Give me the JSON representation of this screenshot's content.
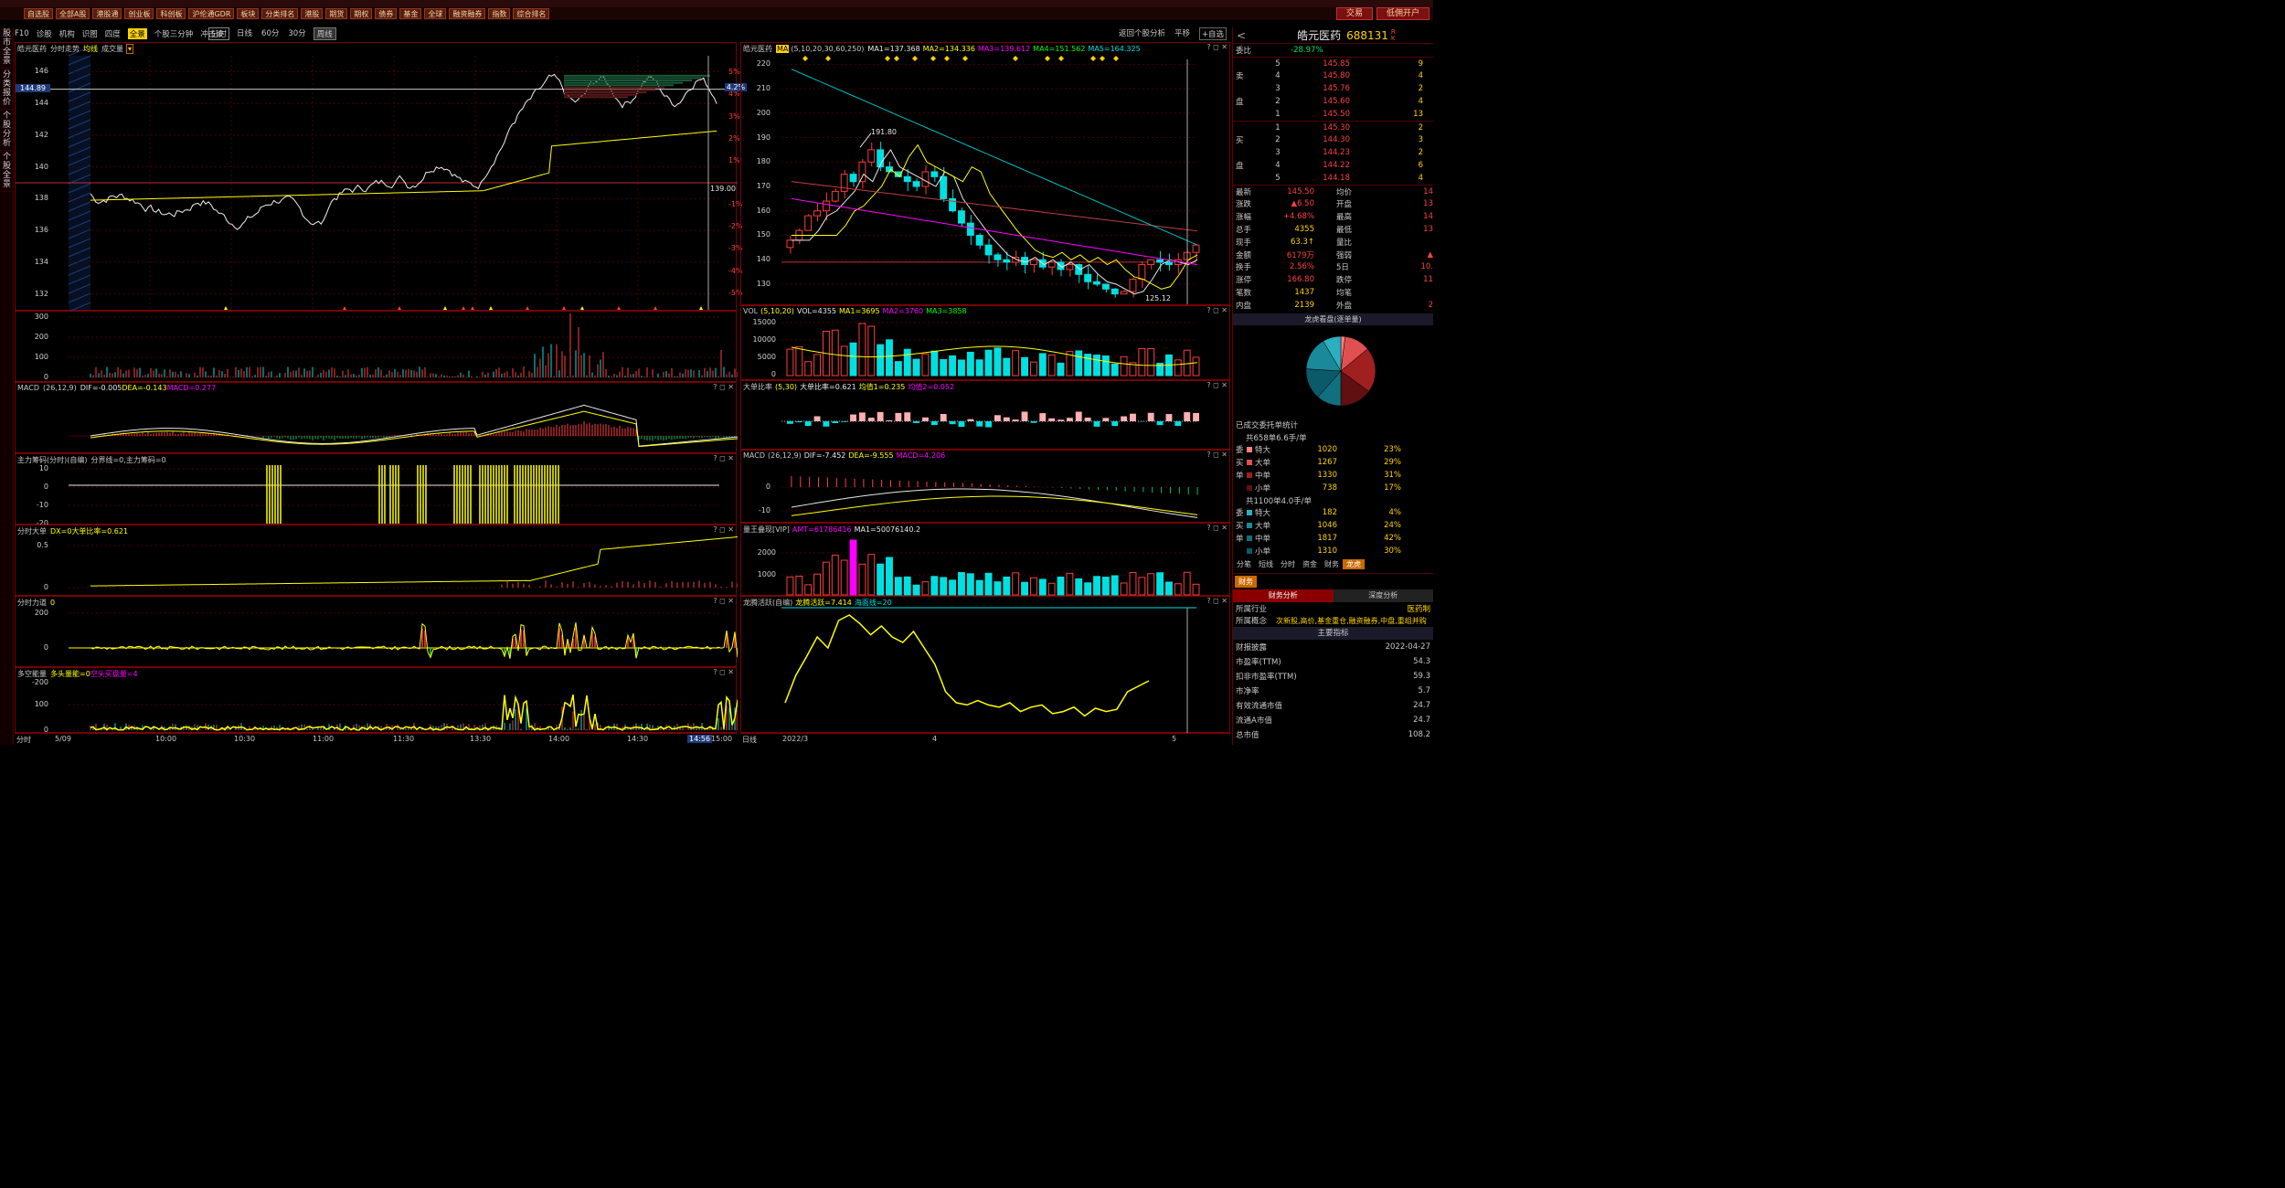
{
  "menu": [
    "自选股",
    "全部A股",
    "港股通",
    "创业板",
    "科创板",
    "沪伦通GDR",
    "板块",
    "分类排名",
    "港股",
    "期货",
    "期权",
    "债券",
    "基金",
    "全球",
    "融资融券",
    "指数",
    "综合排名"
  ],
  "trade": {
    "buy": "交易",
    "open_account": "低佣开户"
  },
  "left_tabs": [
    "股市全景",
    "分类报价",
    "个股分析",
    "个股全景"
  ],
  "toolbar": [
    "F10",
    "诊股",
    "机构",
    "识图",
    "四度",
    "全景",
    "个股三分钟",
    "冲击波"
  ],
  "periods": {
    "items": [
      "分时",
      "日线",
      "60分",
      "30分"
    ],
    "week": "周线"
  },
  "right_toolbar": {
    "back": "返回个股分析",
    "flat": "平移",
    "watch": "+自选"
  },
  "colors": {
    "up": "#ff3c3c",
    "down": "#00e0e0",
    "grid": "#7a0000",
    "yellow": "#ffff00",
    "magenta": "#ff00ff"
  },
  "intraday": {
    "title": "皓元医药",
    "subtitle": "分时走势",
    "avg_label": "均线",
    "vol_label": "成交量",
    "price_ticks": [
      "146",
      "144",
      "142",
      "140",
      "138",
      "136",
      "134",
      "132"
    ],
    "current_price": "144.89",
    "prev_close": "139.00",
    "pct_ticks": [
      "5%",
      "4%",
      "3%",
      "2%",
      "1%",
      "-1%",
      "-2%",
      "-3%",
      "-4%",
      "-5%"
    ],
    "current_pct": "4.2%",
    "x_ticks": [
      "5/09",
      "10:00",
      "10:30",
      "11:00",
      "11:30",
      "13:30",
      "14:00",
      "14:30",
      "14:56",
      "15:00"
    ],
    "time_menu": "分时"
  },
  "vol_panel": {
    "ticks": [
      "300",
      "200",
      "100",
      "0"
    ]
  },
  "macd_intraday": {
    "title": "MACD",
    "params": "(26,12,9)",
    "dif": "DIF=-0.005",
    "dea": "DEA=-0.143",
    "macd": "MACD=0.277"
  },
  "main_chip": {
    "title": "主力筹码(分时)(自编)",
    "text": "分界线=0,主力筹码=0",
    "ticks": [
      "10",
      "0",
      "-10",
      "-20"
    ]
  },
  "big_order": {
    "title": "分时大单",
    "dx": "DX=0",
    "ratio": "大单比率=0.621",
    "ticks": [
      "0.5",
      "0"
    ]
  },
  "force": {
    "title": "分时力道",
    "value": "0",
    "ticks": [
      "200",
      "0",
      "-200"
    ]
  },
  "energy": {
    "title": "多空能量",
    "bull": "多头量能=0",
    "bear": "空头买盘量=4",
    "ticks": [
      "100",
      "0"
    ]
  },
  "daily": {
    "title": "皓元医药",
    "ma_btn": "MA",
    "ma_params": "(5,10,20,30,60,250)",
    "ma1": "MA1=137.368",
    "ma2": "MA2=134.336",
    "ma3": "MA3=139.612",
    "ma4": "MA4=151.562",
    "ma5": "MA5=164.325",
    "ticks": [
      "220",
      "210",
      "200",
      "190",
      "180",
      "170",
      "160",
      "150",
      "140",
      "130"
    ],
    "high_label": "191.80",
    "low_label": "125.12",
    "x_ticks": [
      "2022/3",
      "4",
      "5"
    ],
    "period": "日线"
  },
  "vol_daily": {
    "title": "VOL",
    "params": "(5,10,20)",
    "vol": "VOL=4355",
    "ma1": "MA1=3695",
    "ma2": "MA2=3760",
    "ma3": "MA3=3858",
    "ticks": [
      "15000",
      "10000",
      "5000",
      "0"
    ]
  },
  "big_ratio": {
    "title": "大单比率",
    "params": "(5,30)",
    "ratio": "大单比率=0.621",
    "avg1": "均值1=0.235",
    "avg2": "均值2=0.052"
  },
  "macd_daily": {
    "title": "MACD",
    "params": "(26,12,9)",
    "dif": "DIF=-7.452",
    "dea": "DEA=-9.555",
    "macd": "MACD=4.206",
    "ticks": [
      "0",
      "-10"
    ]
  },
  "vol_king": {
    "title": "量王叠现[VIP]",
    "amt": "AMT=61786416",
    "ma1": "MA1=50076140.2",
    "ticks": [
      "2000",
      "1000"
    ]
  },
  "dragon": {
    "title": "龙腾活跃(自编)",
    "active": "龙腾活跃=7.414",
    "sea": "海面线=20"
  },
  "quote": {
    "name": "皓元医药",
    "code": "688131",
    "rk": "R K",
    "wei_label": "委比",
    "wei_value": "-28.97%",
    "sell": [
      [
        "5",
        "145.85",
        "9"
      ],
      [
        "4",
        "145.80",
        "4"
      ],
      [
        "3",
        "145.76",
        "2"
      ],
      [
        "2",
        "145.60",
        "4"
      ],
      [
        "1",
        "145.50",
        "13"
      ]
    ],
    "buy": [
      [
        "1",
        "145.30",
        "2"
      ],
      [
        "2",
        "144.30",
        "3"
      ],
      [
        "3",
        "144.23",
        "2"
      ],
      [
        "4",
        "144.22",
        "6"
      ],
      [
        "5",
        "144.18",
        "4"
      ]
    ],
    "sell_label": "卖",
    "buy_label": "买",
    "pan_label": "盘",
    "stats": [
      [
        "最新",
        "145.50",
        "均价",
        "14"
      ],
      [
        "涨跌",
        "▲6.50",
        "开盘",
        "13"
      ],
      [
        "涨幅",
        "+4.68%",
        "最高",
        "14"
      ],
      [
        "总手",
        "4355",
        "最低",
        "13"
      ],
      [
        "现手",
        "63.3↑",
        "量比",
        ""
      ],
      [
        "金额",
        "6179万",
        "强弱",
        "▲"
      ],
      [
        "换手",
        "2.56%",
        "5日",
        "10."
      ],
      [
        "涨停",
        "166.80",
        "跌停",
        "11"
      ],
      [
        "笔数",
        "1437",
        "均笔",
        ""
      ],
      [
        "内盘",
        "2139",
        "外盘",
        "2"
      ]
    ]
  },
  "dragon_panel": {
    "title": "龙虎看盘(逐单量)",
    "stat_title": "已成交委托单统计",
    "sell_summary": {
      "total": "共658单6.6手/单",
      "rows": [
        [
          "特大",
          "1020",
          "23%"
        ],
        [
          "大单",
          "1267",
          "29%"
        ],
        [
          "中单",
          "1330",
          "31%"
        ],
        [
          "小单",
          "738",
          "17%"
        ]
      ]
    },
    "buy_summary": {
      "total": "共1100单4.0手/单",
      "rows": [
        [
          "特大",
          "182",
          "4%"
        ],
        [
          "大单",
          "1046",
          "24%"
        ],
        [
          "中单",
          "1817",
          "42%"
        ],
        [
          "小单",
          "1310",
          "30%"
        ]
      ]
    },
    "side_labels": [
      "委",
      "买",
      "单"
    ],
    "tabs": [
      "分笔",
      "短线",
      "分时",
      "资金",
      "财务",
      "龙虎"
    ]
  },
  "finance": {
    "tab": "财务",
    "sub_tabs": [
      "财务分析",
      "深度分析"
    ],
    "industry_label": "所属行业",
    "industry": "医药制",
    "concept_label": "所属概念",
    "concept": "次新股,高价,基金重仓,融资融券,中盘,重组并购",
    "main_title": "主要指标",
    "rows": [
      [
        "财报披露",
        "2022-04-27"
      ],
      [
        "市盈率(TTM)",
        "54.3"
      ],
      [
        "扣非市盈率(TTM)",
        "59.3"
      ],
      [
        "市净率",
        "5.7"
      ],
      [
        "有效流通市值",
        "24.7"
      ],
      [
        "流通A市值",
        "24.7"
      ],
      [
        "总市值",
        "108.2"
      ]
    ]
  }
}
